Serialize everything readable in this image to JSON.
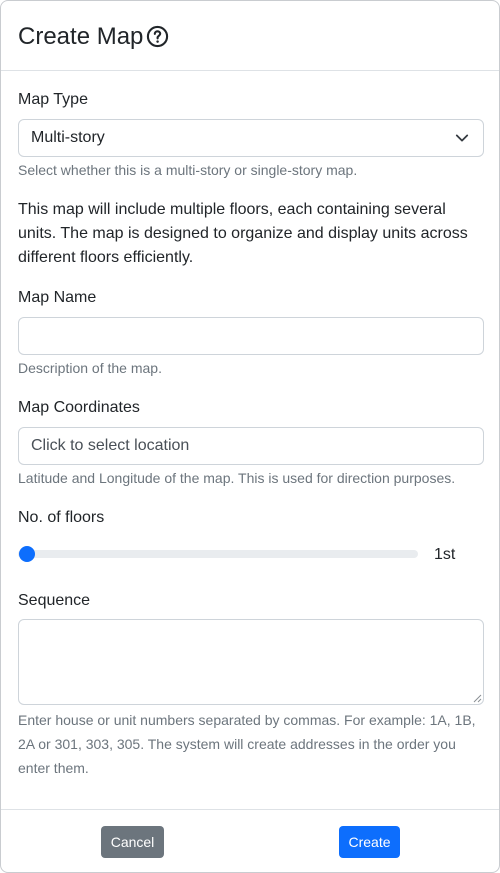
{
  "modal": {
    "title": "Create Map"
  },
  "map_type": {
    "label": "Map Type",
    "selected": "Multi-story",
    "hint": "Select whether this is a multi-story or single-story map.",
    "description": "This map will include multiple floors, each containing several units. The map is designed to organize and display units across different floors efficiently."
  },
  "map_name": {
    "label": "Map Name",
    "value": "",
    "hint": "Description of the map."
  },
  "map_coordinates": {
    "label": "Map Coordinates",
    "placeholder": "Click to select location",
    "hint": "Latitude and Longitude of the map. This is used for direction purposes."
  },
  "floors": {
    "label": "No. of floors",
    "value_label": "1st",
    "slider_fraction": 0.0
  },
  "sequence": {
    "label": "Sequence",
    "value": "",
    "hint": "Enter house or unit numbers separated by commas. For example: 1A, 1B, 2A or 301, 303, 305. The system will create addresses in the order you enter them."
  },
  "footer": {
    "cancel_label": "Cancel",
    "create_label": "Create"
  },
  "colors": {
    "primary": "#0d6efd",
    "secondary": "#6c757d",
    "muted_text": "#6c757d",
    "border": "#ced4da"
  },
  "icons": {
    "help": "question-circle-icon",
    "select_chevron": "chevron-down-icon"
  }
}
